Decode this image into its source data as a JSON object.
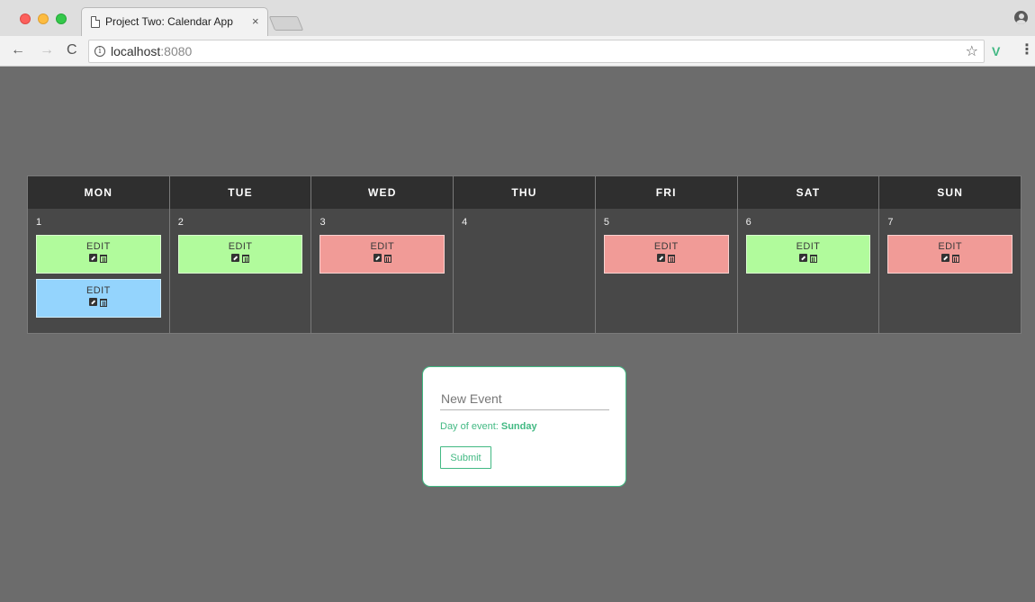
{
  "browser": {
    "tab_title": "Project Two: Calendar App",
    "tab_close": "×",
    "url_host": "localhost",
    "url_port": ":8080",
    "nav_back": "←",
    "nav_forward": "→",
    "nav_reload": "C",
    "info_icon": "i",
    "star_icon": "☆",
    "vue_icon": "V",
    "menu_icon": "⋮"
  },
  "calendar": {
    "days": [
      {
        "name": "MON",
        "number": "1",
        "events": [
          {
            "label": "EDIT",
            "color": "green"
          },
          {
            "label": "EDIT",
            "color": "blue"
          }
        ]
      },
      {
        "name": "TUE",
        "number": "2",
        "events": [
          {
            "label": "EDIT",
            "color": "green"
          }
        ]
      },
      {
        "name": "WED",
        "number": "3",
        "events": [
          {
            "label": "EDIT",
            "color": "red"
          }
        ]
      },
      {
        "name": "THU",
        "number": "4",
        "events": []
      },
      {
        "name": "FRI",
        "number": "5",
        "events": [
          {
            "label": "EDIT",
            "color": "red"
          }
        ]
      },
      {
        "name": "SAT",
        "number": "6",
        "events": [
          {
            "label": "EDIT",
            "color": "green"
          }
        ]
      },
      {
        "name": "SUN",
        "number": "7",
        "events": [
          {
            "label": "EDIT",
            "color": "red"
          }
        ]
      }
    ]
  },
  "event_colors": {
    "green": "#b1fb9c",
    "red": "#f19b97",
    "blue": "#94d4fd"
  },
  "form": {
    "input_placeholder": "New Event",
    "day_label": "Day of event: ",
    "day_value": "Sunday",
    "submit_label": "Submit",
    "accent_color": "#42b983"
  }
}
